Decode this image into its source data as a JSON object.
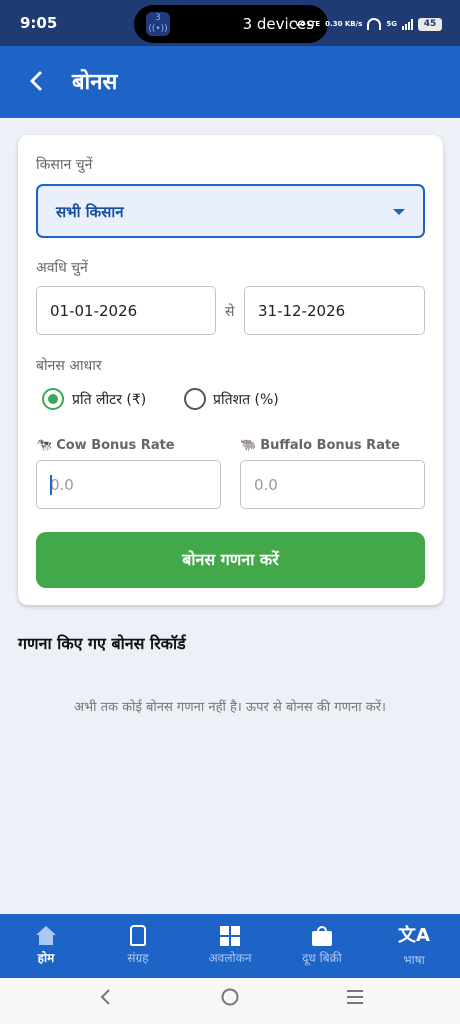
{
  "status": {
    "time": "9:05",
    "devices": "3 devices",
    "device_badge": "3",
    "volte": "Vo LTE",
    "speed": "0.30 KB/s",
    "network": "5G",
    "battery": "45"
  },
  "appbar": {
    "back_icon": "chevron-left-icon",
    "title": "बोनस"
  },
  "form": {
    "farmer_label": "किसान चुनें",
    "farmer_value": "सभी किसान",
    "period_label": "अवधि चुनें",
    "from_date": "01-01-2026",
    "to_word": "से",
    "to_date": "31-12-2026",
    "basis_label": "बोनस आधार",
    "basis_options": [
      "प्रति लीटर (₹)",
      "प्रतिशत (%)"
    ],
    "basis_selected": "प्रति लीटर (₹)",
    "cow_label": "Cow Bonus Rate",
    "cow_icon": "🐄",
    "cow_placeholder": "0.0",
    "buffalo_label": "Buffalo Bonus Rate",
    "buffalo_icon": "🐃",
    "buffalo_placeholder": "0.0",
    "calculate_label": "बोनस गणना करें"
  },
  "records": {
    "title": "गणना किए गए बोनस रिकॉर्ड",
    "empty_message": "अभी तक कोई बोनस गणना नहीं है। ऊपर से बोनस की गणना करें।"
  },
  "bottom_nav": [
    {
      "label": "होम",
      "icon": "home-icon",
      "active": true
    },
    {
      "label": "संग्रह",
      "icon": "milk-can-icon",
      "active": false
    },
    {
      "label": "अवलोकन",
      "icon": "dashboard-grid-icon",
      "active": false
    },
    {
      "label": "दूध बिक्री",
      "icon": "shopping-bag-icon",
      "active": false
    },
    {
      "label": "भाषा",
      "icon": "translate-icon",
      "active": false
    }
  ],
  "colors": {
    "primary": "#1e64c7",
    "status_bar": "#1f3b73",
    "accent_green": "#43a84a",
    "background": "#eef0f7"
  }
}
